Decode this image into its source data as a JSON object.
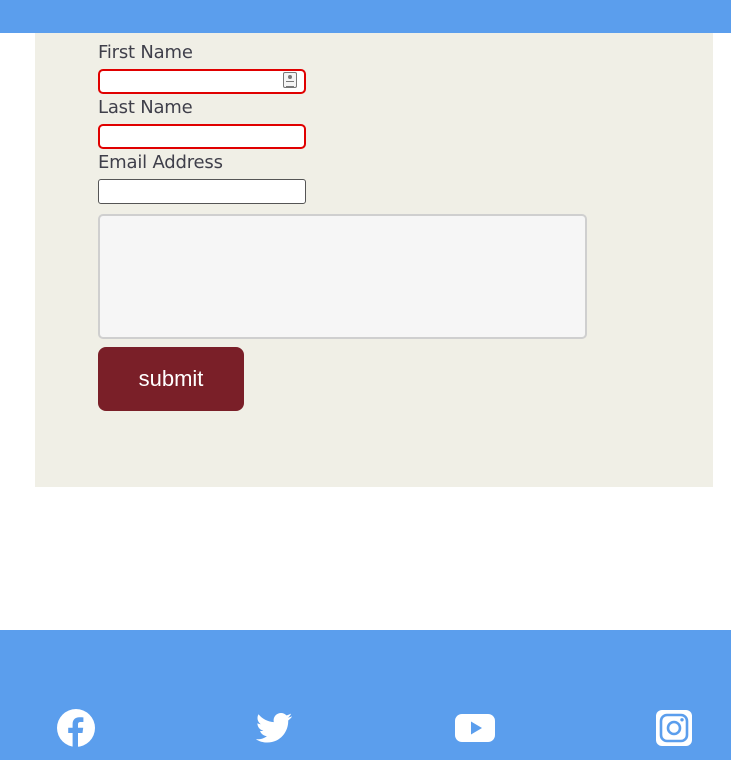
{
  "form": {
    "first_name": {
      "label": "First Name",
      "value": ""
    },
    "last_name": {
      "label": "Last Name",
      "value": ""
    },
    "email": {
      "label": "Email Address",
      "value": ""
    },
    "message": {
      "value": ""
    },
    "submit_label": "submit"
  },
  "footer": {
    "social": [
      {
        "icon": "facebook-icon"
      },
      {
        "icon": "twitter-icon"
      },
      {
        "icon": "youtube-icon"
      },
      {
        "icon": "instagram-icon"
      }
    ]
  },
  "colors": {
    "header_footer_bg": "#5b9eed",
    "form_panel_bg": "#f0efe6",
    "submit_bg": "#7a1f28",
    "invalid_border": "#e00000"
  }
}
